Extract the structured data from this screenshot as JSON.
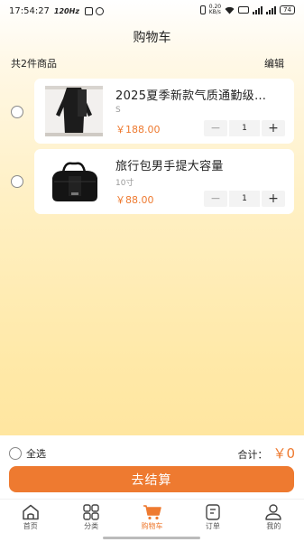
{
  "status_bar": {
    "time": "17:54:27",
    "speed": "120Hz",
    "net": "0.20\nKB/s",
    "battery": "74"
  },
  "header": {
    "title": "购物车"
  },
  "summary": {
    "count_text": "共2件商品",
    "edit_label": "编辑"
  },
  "cart_items": [
    {
      "title": "2025夏季新款气质通勤级…",
      "spec": "S",
      "price": "￥188.00",
      "qty": "1",
      "minus": "−",
      "plus": "+"
    },
    {
      "title": "旅行包男手提大容量",
      "spec": "10寸",
      "price": "￥88.00",
      "qty": "1",
      "minus": "−",
      "plus": "+"
    }
  ],
  "footer": {
    "select_all_label": "全选",
    "total_label": "合计：",
    "total_amount": "￥0",
    "checkout_label": "去结算"
  },
  "tabs": [
    {
      "label": "首页",
      "icon": "home-icon",
      "active": false
    },
    {
      "label": "分类",
      "icon": "grid-icon",
      "active": false
    },
    {
      "label": "购物车",
      "icon": "cart-icon",
      "active": true
    },
    {
      "label": "订单",
      "icon": "order-icon",
      "active": false
    },
    {
      "label": "我的",
      "icon": "user-icon",
      "active": false
    }
  ],
  "colors": {
    "accent": "#ee7a30"
  }
}
